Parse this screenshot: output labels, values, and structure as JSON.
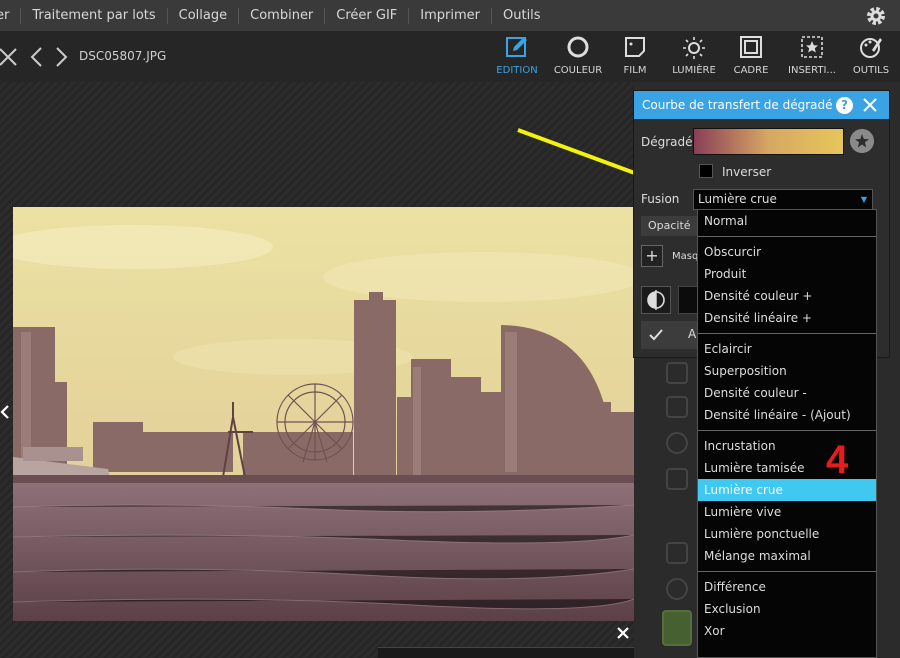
{
  "menu": {
    "items": [
      {
        "label": "er"
      },
      {
        "label": "Traitement par lots"
      },
      {
        "label": "Collage"
      },
      {
        "label": "Combiner"
      },
      {
        "label": "Créer GIF"
      },
      {
        "label": "Imprimer"
      },
      {
        "label": "Outils"
      }
    ]
  },
  "toolbar": {
    "filename": "DSC05807.JPG",
    "tools": [
      {
        "label": "EDITION",
        "icon": "edit-icon",
        "active": true
      },
      {
        "label": "COULEUR",
        "icon": "color-icon"
      },
      {
        "label": "FILM",
        "icon": "film-icon"
      },
      {
        "label": "LUMIÈRE",
        "icon": "light-icon"
      },
      {
        "label": "CADRE",
        "icon": "frame-icon"
      },
      {
        "label": "INSERTI...",
        "icon": "insert-icon"
      },
      {
        "label": "OUTILS",
        "icon": "tools-icon"
      }
    ]
  },
  "panel": {
    "title": "Courbe de transfert de dégradé",
    "gradient_label": "Dégradé",
    "invert_label": "Inverser",
    "fusion_label": "Fusion",
    "fusion_value": "Lumière crue",
    "opacity_label": "Opacité",
    "mask_label": "Masq",
    "apply_label": "A",
    "colors": {
      "header": "#3aa3e3",
      "gradient_start": "#8a3e58",
      "gradient_end": "#e6c65a"
    }
  },
  "dropdown": {
    "groups": [
      [
        "Normal"
      ],
      [
        "Obscurcir",
        "Produit",
        "Densité couleur +",
        "Densité linéaire +"
      ],
      [
        "Eclaircir",
        "Superposition",
        "Densité couleur -",
        "Densité linéaire - (Ajout)"
      ],
      [
        "Incrustation",
        "Lumière tamisée",
        "Lumière crue",
        "Lumière vive",
        "Lumière ponctuelle",
        "Mélange maximal"
      ],
      [
        "Différence",
        "Exclusion",
        "Xor"
      ]
    ],
    "selected": "Lumière crue",
    "selected_color": "#3fc8f0"
  },
  "annotation": {
    "step": "4",
    "arrow_color": "#f2f20a",
    "step_color": "#e51d1d"
  }
}
